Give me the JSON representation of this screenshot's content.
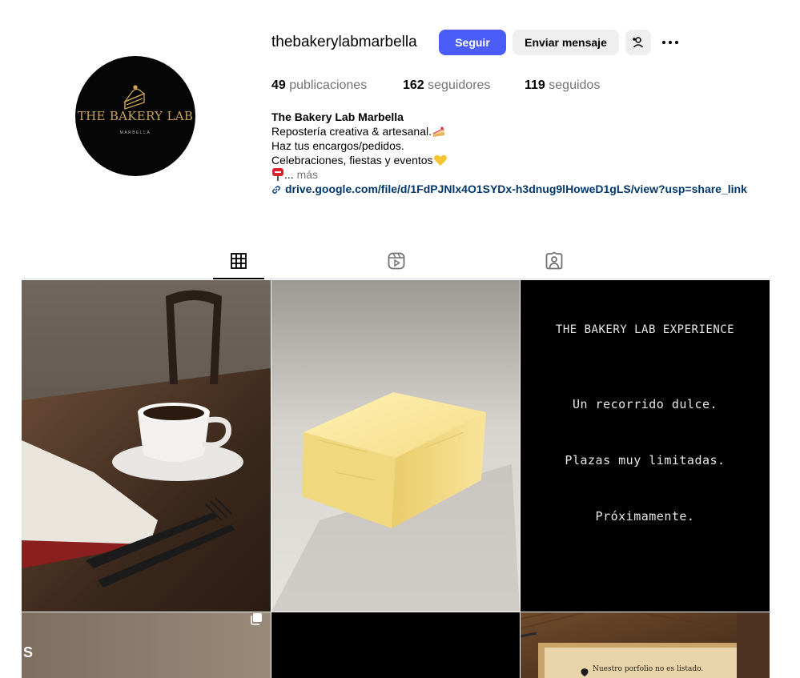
{
  "profile": {
    "username": "thebakerylabmarbella",
    "logo": {
      "line1": "THE BAKERY LAB",
      "line2": "MARBELLA"
    },
    "actions": {
      "follow_label": "Seguir",
      "message_label": "Enviar mensaje",
      "add_user_icon": "person-add-icon",
      "more_icon": "more-horizontal-icon"
    },
    "stats": {
      "posts_count": "49",
      "posts_label": "publicaciones",
      "followers_count": "162",
      "followers_label": "seguidores",
      "following_count": "119",
      "following_label": "seguidos"
    },
    "bio": {
      "name": "The Bakery Lab Marbella",
      "line1": "Repostería creativa & artesanal.",
      "line1_emoji": "cake-emoji",
      "line2": "Haz tus encargos/pedidos.",
      "line3": "Celebraciones, fiestas y eventos",
      "line3_emoji": "yellow-heart-emoji",
      "line4_emoji": "postbox-emoji",
      "line4": "...",
      "more_label": "más",
      "link": "drive.google.com/file/d/1FdPJNlx4O1SYDx-h3dnug9lHoweD1gLS/view?usp=share_link"
    }
  },
  "tabs": [
    {
      "id": "posts",
      "icon": "grid-icon",
      "active": true
    },
    {
      "id": "reels",
      "icon": "reels-icon",
      "active": false
    },
    {
      "id": "tagged",
      "icon": "tagged-icon",
      "active": false
    }
  ],
  "posts": {
    "p1": {
      "description_icon": "coffee-cup-photo"
    },
    "p2": {
      "description_icon": "butter-photo"
    },
    "p3": {
      "title": "THE BAKERY LAB EXPERIENCE",
      "line1": "Un recorrido dulce.",
      "line2": "Plazas muy limitadas.",
      "line3": "Próximamente."
    },
    "p4": {
      "visible_letter": "S",
      "multi_icon": "carousel-icon"
    },
    "p5": {},
    "p6": {
      "note_text": "Nuestro porfolio no es listado."
    }
  },
  "colors": {
    "accent": "#4a5df9",
    "secondary_button": "#efefef",
    "link": "#00376b",
    "muted_text": "#737373"
  }
}
